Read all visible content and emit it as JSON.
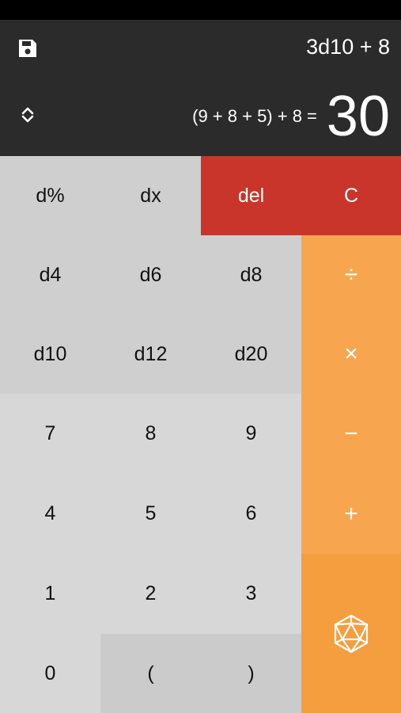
{
  "header": {
    "expression": "3d10 + 8",
    "breakdown": "(9 + 8 + 5) + 8 =",
    "result": "30",
    "icons": {
      "save": "save-icon",
      "sort": "sort-icon"
    }
  },
  "keypad": {
    "rows": [
      [
        "d%",
        "dx",
        "del",
        "C"
      ],
      [
        "d4",
        "d6",
        "d8",
        "÷"
      ],
      [
        "d10",
        "d12",
        "d20",
        "×"
      ],
      [
        "7",
        "8",
        "9",
        "−"
      ],
      [
        "4",
        "5",
        "6",
        "+"
      ],
      [
        "1",
        "2",
        "3"
      ],
      [
        "0",
        "(",
        ")"
      ]
    ],
    "roll_icon": "d20-icon"
  },
  "colors": {
    "header_bg": "#2b2b2b",
    "dice_key": "#cfcfcf",
    "number_key": "#d7d7d7",
    "delete_clear": "#c9352a",
    "operator": "#f7a64f",
    "roll": "#f59e3f"
  }
}
